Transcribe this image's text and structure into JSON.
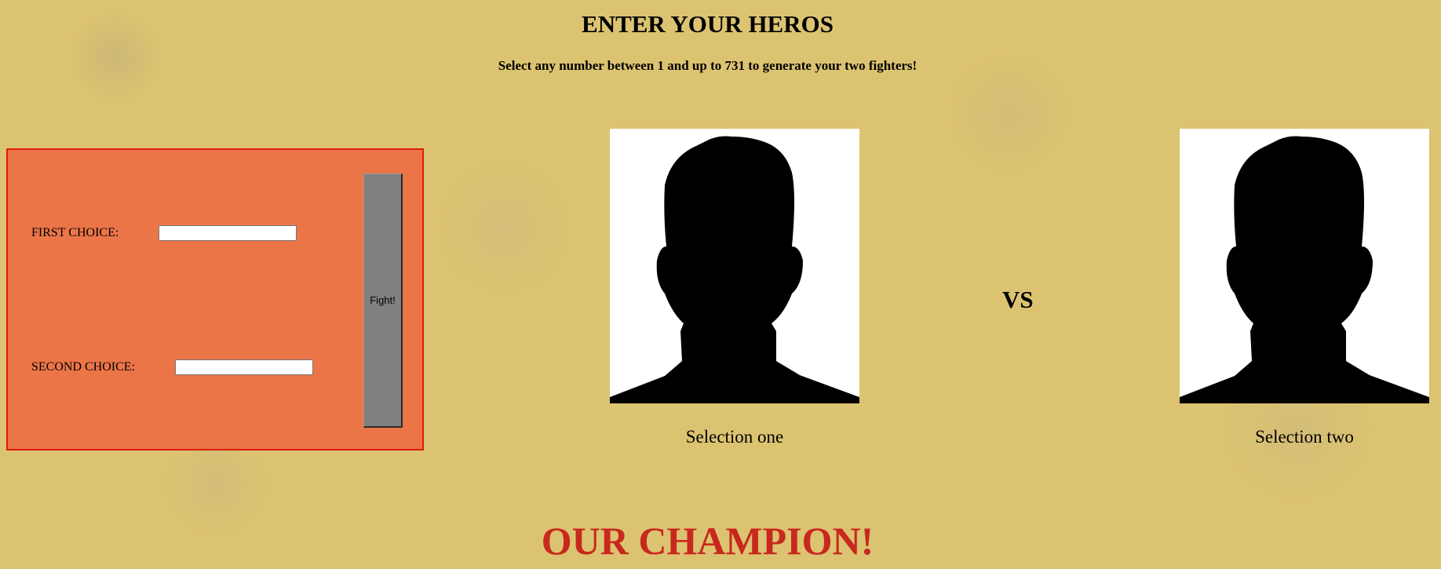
{
  "header": {
    "title": "ENTER YOUR HEROS",
    "instructions": "Select any number between 1 and up to 731 to generate your two fighters!"
  },
  "form": {
    "first_choice_label": "FIRST CHOICE:",
    "first_choice_value": "",
    "second_choice_label": "SECOND CHOICE:",
    "second_choice_value": "",
    "fight_button_label": "Fight!"
  },
  "arena": {
    "fighter_one_caption": "Selection one",
    "fighter_two_caption": "Selection two",
    "fighter_one_icon": "person-silhouette-icon",
    "fighter_two_icon": "person-silhouette-icon",
    "versus_label": "VS"
  },
  "result": {
    "champion_heading": "OUR CHAMPION!"
  },
  "colors": {
    "background": "#dcc371",
    "panel": "#ec7548",
    "panel_border": "#e01a10",
    "button": "#808080",
    "champion_text": "#c8281d"
  }
}
